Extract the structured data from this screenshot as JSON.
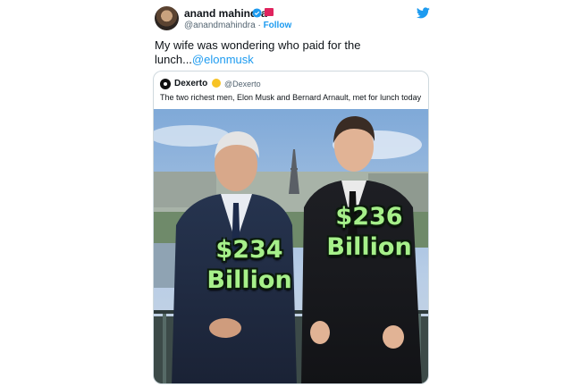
{
  "tweet": {
    "author_name": "anand mahindra",
    "handle": "@anandmahindra",
    "separator": "·",
    "follow_label": "Follow",
    "text": "My wife was wondering who paid for the lunch...",
    "mention": "@elonmusk",
    "icons": [
      "avatar",
      "verified-badge-icon",
      "flag-icon",
      "twitter-bird-icon"
    ],
    "accent_color": "#1d9bf0"
  },
  "quote": {
    "author_name": "Dexerto",
    "handle": "@Dexerto",
    "text": "The two richest men, Elon Musk and Bernard Arnault, met for lunch today",
    "image": {
      "left_caption_value": "$234",
      "left_caption_unit": "Billion",
      "right_caption_value": "$236",
      "right_caption_unit": "Billion",
      "caption_color": "#a6f08a"
    }
  }
}
